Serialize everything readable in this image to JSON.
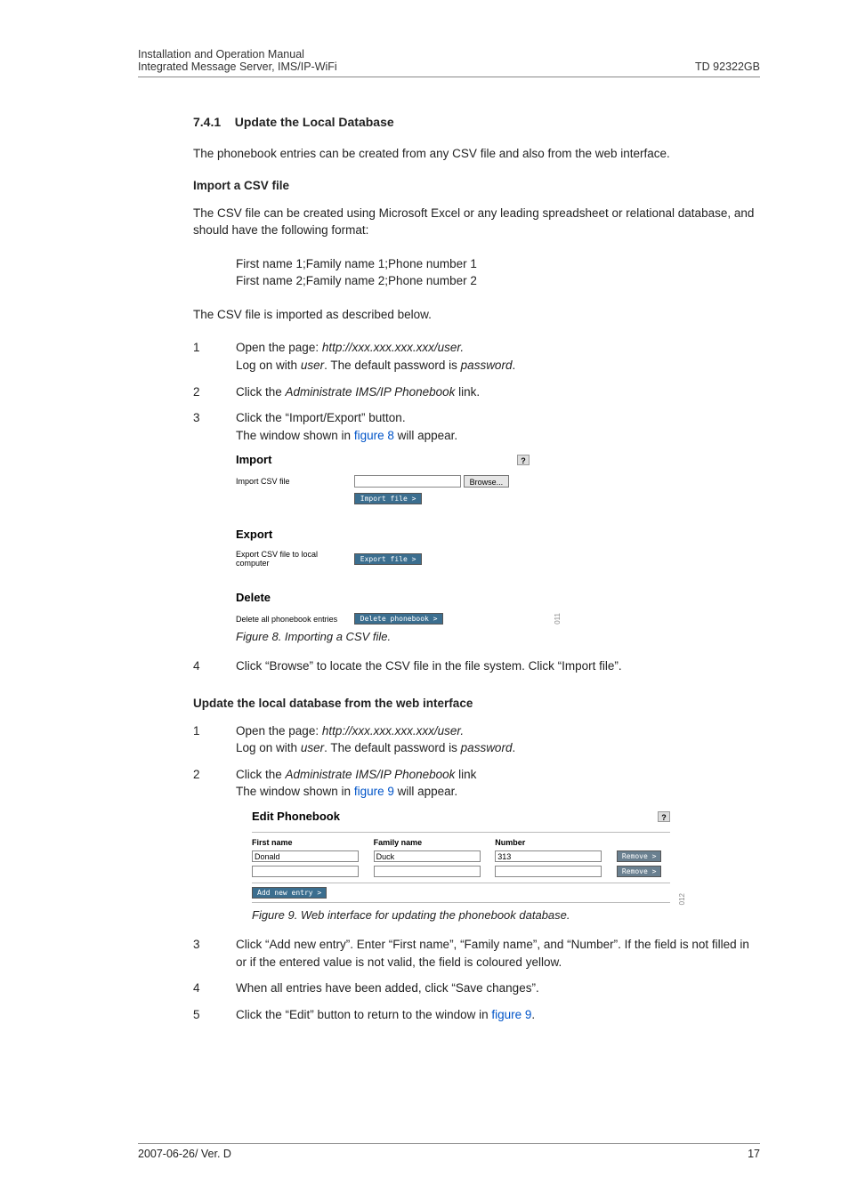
{
  "header": {
    "left_line1": "Installation and Operation Manual",
    "left_line2": "Integrated Message Server, IMS/IP-WiFi",
    "right": "TD 92322GB"
  },
  "section": {
    "number": "7.4.1",
    "title": "Update the Local Database",
    "intro": "The phonebook entries can be created from any CSV file and also from the web interface."
  },
  "import_csv": {
    "heading": "Import a CSV file",
    "para": "The CSV file can be created using Microsoft Excel or any leading spreadsheet or relational database, and should have the following format:",
    "format_line1": "First name 1;Family name 1;Phone number 1",
    "format_line2": "First name 2;Family name 2;Phone number 2",
    "para2": "The CSV file is imported as described below.",
    "steps": [
      {
        "n": "1",
        "a": "Open the page: ",
        "i": "http://xxx.xxx.xxx.xxx/user.",
        "b": "Log on with ",
        "c": "user",
        "d": ". The default password is ",
        "e": "password",
        "f": "."
      },
      {
        "n": "2",
        "a": "Click the ",
        "i": "Administrate IMS/IP Phonebook",
        "b": " link."
      },
      {
        "n": "3",
        "a": "Click the “Import/Export” button.",
        "b": "The window shown in ",
        "link": "figure 8",
        "c": " will appear."
      }
    ],
    "figure8": {
      "import_h": "Import",
      "import_lbl": "Import CSV file",
      "browse": "Browse...",
      "import_btn": "Import file >",
      "export_h": "Export",
      "export_lbl": "Export CSV file to local computer",
      "export_btn": "Export file >",
      "delete_h": "Delete",
      "delete_lbl": "Delete all phonebook entries",
      "delete_btn": "Delete phonebook >",
      "help": "?",
      "code": "011"
    },
    "figcap8": "Figure 8. Importing a CSV file.",
    "step4": {
      "n": "4",
      "t": "Click “Browse” to locate the CSV file in the file system. Click “Import file”."
    }
  },
  "update_web": {
    "heading": "Update the local database from the web interface",
    "steps12": [
      {
        "n": "1",
        "a": "Open the page: ",
        "i": "http://xxx.xxx.xxx.xxx/user.",
        "b": "Log on with ",
        "c": "user",
        "d": ". The default password is ",
        "e": "password",
        "f": "."
      },
      {
        "n": "2",
        "a": "Click the ",
        "i": "Administrate IMS/IP Phonebook",
        "b": " link",
        "c": "The window shown in ",
        "link": "figure 9",
        "d": " will appear."
      }
    ],
    "figure9": {
      "title": "Edit Phonebook",
      "help": "?",
      "col1": "First name",
      "col2": "Family name",
      "col3": "Number",
      "row1": {
        "first": "Donald",
        "family": "Duck",
        "number": "313"
      },
      "remove": "Remove >",
      "add": "Add new entry >",
      "code": "012"
    },
    "figcap9": "Figure 9. Web interface for updating the phonebook database.",
    "step3": {
      "n": "3",
      "t": "Click “Add new entry”. Enter “First name”, “Family name”, and “Number”. If the field is not filled in or if the entered value is not valid, the field is coloured yellow."
    },
    "step4": {
      "n": "4",
      "t": "When all entries have been added, click “Save changes”."
    },
    "step5": {
      "n": "5",
      "a": "Click the “Edit” button to return to the window in ",
      "link": "figure 9",
      "b": "."
    }
  },
  "footer": {
    "left": "2007-06-26/ Ver. D",
    "right": "17"
  }
}
